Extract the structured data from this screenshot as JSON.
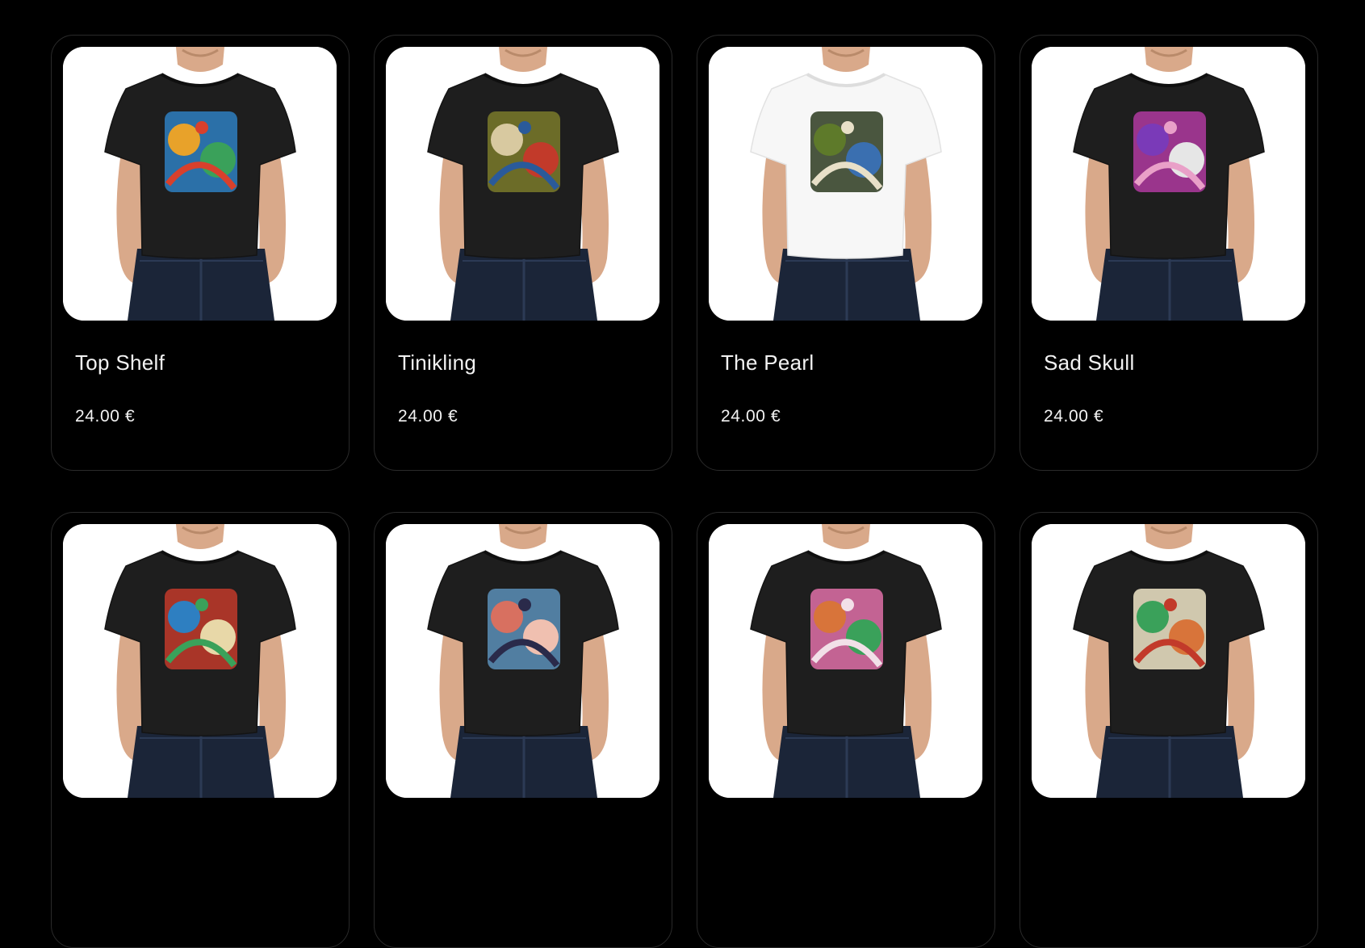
{
  "products": [
    {
      "title": "Top Shelf",
      "price": "24.00 €",
      "shirt_color": "#1e1e1e",
      "artwork": "vases-and-bottles-graphic",
      "art_colors": [
        "#2e7fc1",
        "#e8a22a",
        "#3aa15a",
        "#d8402c"
      ]
    },
    {
      "title": "Tinikling",
      "price": "24.00 €",
      "shirt_color": "#1e1e1e",
      "artwork": "dancers-graphic",
      "art_colors": [
        "#7a7a2a",
        "#d8c9a0",
        "#c23a2a",
        "#2a5a9a"
      ]
    },
    {
      "title": "The Pearl",
      "price": "24.00 €",
      "shirt_color": "#f7f7f7",
      "artwork": "serpent-monster-graphic",
      "art_colors": [
        "#2c3a1e",
        "#5e7a2a",
        "#3a6fb0",
        "#e8e0c8"
      ]
    },
    {
      "title": "Sad Skull",
      "price": "24.00 €",
      "shirt_color": "#1e1e1e",
      "artwork": "skull-wizard-graphic",
      "art_colors": [
        "#b03aa0",
        "#7a3ab8",
        "#e6e6e6",
        "#e9a0c8"
      ]
    },
    {
      "title": "",
      "price": "",
      "shirt_color": "#1e1e1e",
      "artwork": "triangle-skull-graphic",
      "art_colors": [
        "#c23a2a",
        "#2e7fc1",
        "#e8d8a8",
        "#3aa15a"
      ]
    },
    {
      "title": "",
      "price": "",
      "shirt_color": "#1e1e1e",
      "artwork": "screaming-face-graphic",
      "art_colors": [
        "#5a8fb8",
        "#d87060",
        "#f0c0b0",
        "#2a2a4a"
      ]
    },
    {
      "title": "",
      "price": "",
      "shirt_color": "#1e1e1e",
      "artwork": "pink-creature-graphic",
      "art_colors": [
        "#e070a8",
        "#d8743a",
        "#3aa15a",
        "#f2e0e8"
      ]
    },
    {
      "title": "",
      "price": "",
      "shirt_color": "#1e1e1e",
      "artwork": "butterfly-skulls-graphic",
      "art_colors": [
        "#f0e6c8",
        "#3aa15a",
        "#d8743a",
        "#c23a2a"
      ]
    }
  ]
}
